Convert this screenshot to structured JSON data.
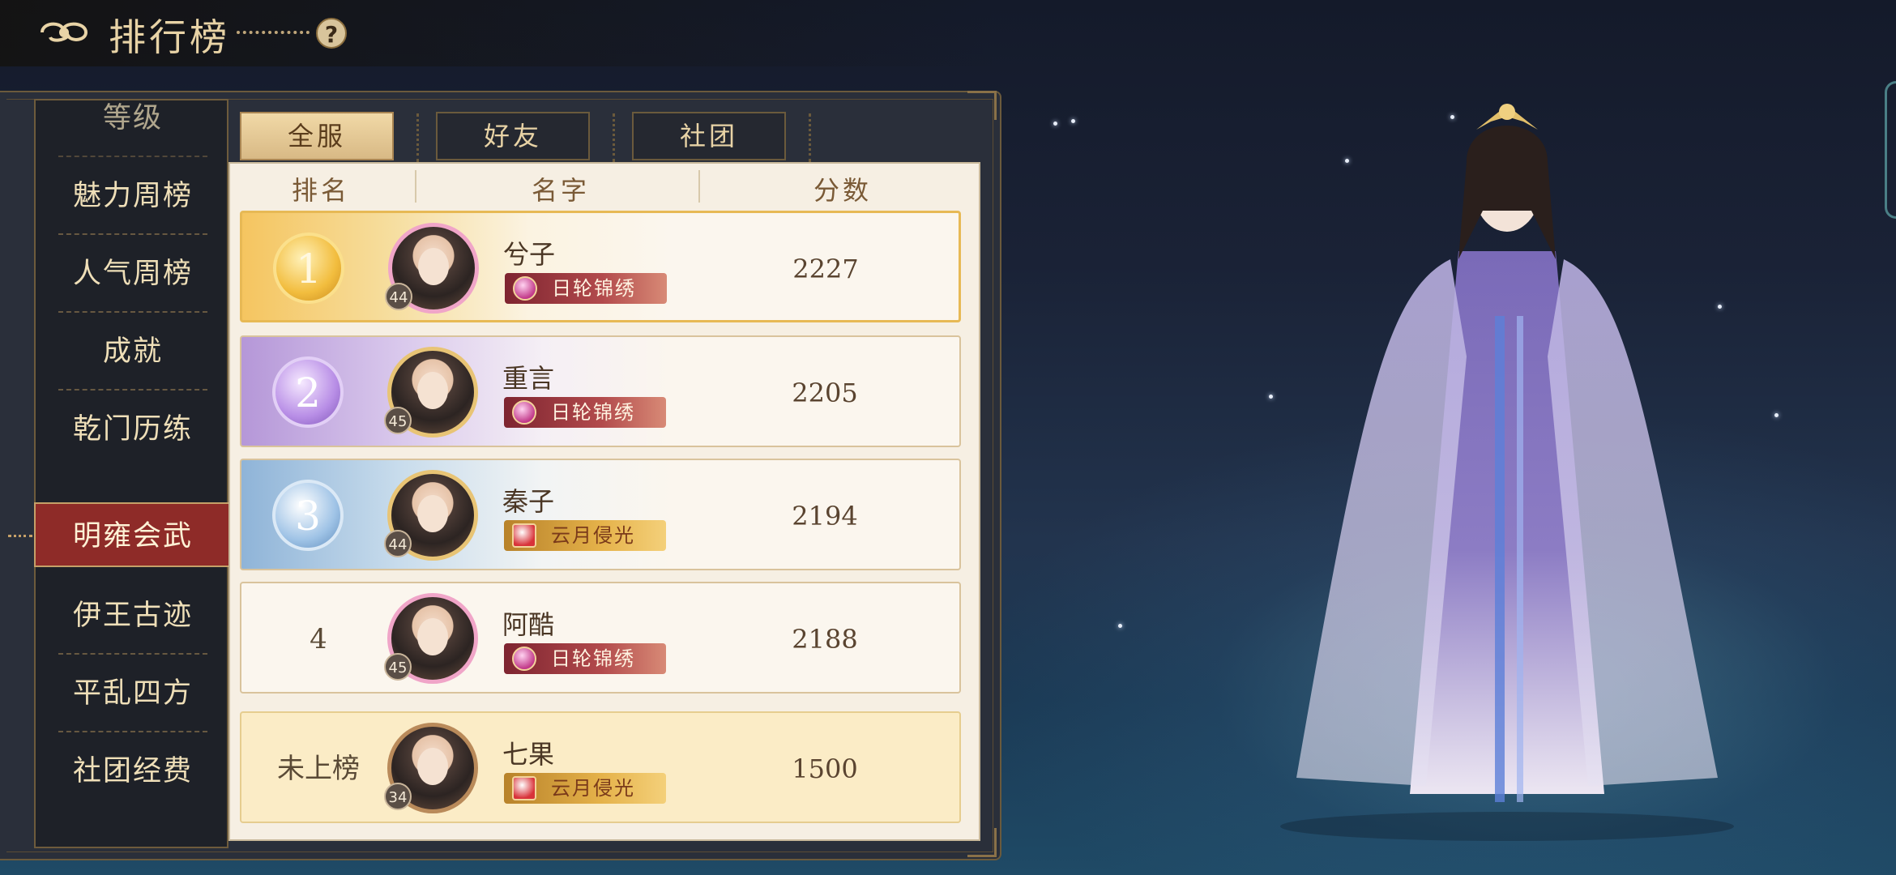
{
  "header": {
    "title": "排行榜",
    "help": "?"
  },
  "sidebar": {
    "items": [
      {
        "label": "等级"
      },
      {
        "label": "魅力周榜"
      },
      {
        "label": "人气周榜"
      },
      {
        "label": "成就"
      },
      {
        "label": "乾门历练"
      },
      {
        "label": "明雍会武",
        "active": true
      },
      {
        "label": "伊王古迹"
      },
      {
        "label": "平乱四方"
      },
      {
        "label": "社团经费"
      }
    ]
  },
  "tabs": [
    {
      "label": "全服",
      "active": true
    },
    {
      "label": "好友"
    },
    {
      "label": "社团"
    }
  ],
  "columns": {
    "rank": "排名",
    "name": "名字",
    "score": "分数"
  },
  "rows": [
    {
      "rank": "1",
      "name": "兮子",
      "level": "44",
      "badge": "日轮锦绣",
      "score": "2227"
    },
    {
      "rank": "2",
      "name": "重言",
      "level": "45",
      "badge": "日轮锦绣",
      "score": "2205"
    },
    {
      "rank": "3",
      "name": "秦子",
      "level": "44",
      "badge": "云月侵光",
      "score": "2194"
    },
    {
      "rank": "4",
      "name": "阿酷",
      "level": "45",
      "badge": "日轮锦绣",
      "score": "2188"
    }
  ],
  "self_row": {
    "rank": "未上榜",
    "name": "七果",
    "level": "34",
    "badge": "云月侵光",
    "score": "1500"
  },
  "colors": {
    "accent_gold": "#e8d3a6",
    "active_red": "#8e2b28",
    "panel_bg": "#f6efe3"
  }
}
